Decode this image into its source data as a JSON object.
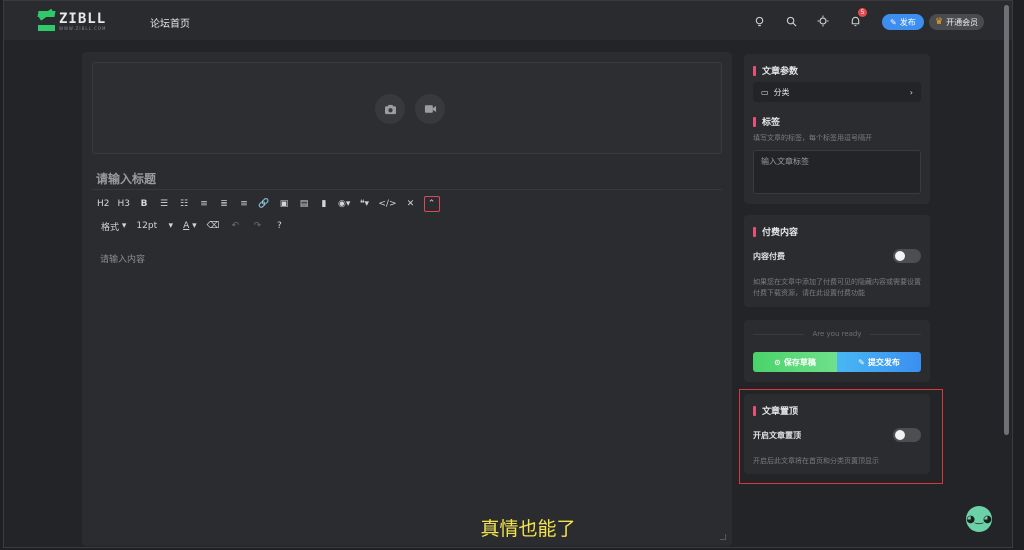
{
  "header": {
    "logo_text": "ZIBLL",
    "logo_sub": "WWW.ZIBLL.COM",
    "nav_home": "论坛首页",
    "notification_count": "5",
    "publish_label": "发布",
    "vip_label": "开通会员"
  },
  "editor": {
    "title_placeholder": "请输入标题",
    "toolbar": {
      "h2": "H2",
      "h3": "H3",
      "bold": "B",
      "format": "格式",
      "font_size": "12pt",
      "font_color": "A"
    },
    "content_placeholder": "请输入内容"
  },
  "sidebar": {
    "params_title": "文章参数",
    "category_label": "分类",
    "tags_title": "标签",
    "tags_hint": "填写文章的标签，每个标签用逗号隔开",
    "tags_placeholder": "输入文章标签",
    "paid_title": "付费内容",
    "paid_toggle_label": "内容付费",
    "paid_hint": "如果您在文章中添加了付费可见的隐藏内容或需要设置付费下载资源，请在此设置付费功能",
    "ready_text": "Are you ready",
    "save_draft": "保存草稿",
    "submit_publish": "提交发布",
    "pin_title": "文章置顶",
    "pin_toggle_label": "开启文章置顶",
    "pin_hint": "开启后此文章将在首页和分类页置顶显示"
  },
  "caption": "真情也能了",
  "icons": {
    "bulb": "bulb-icon",
    "search": "search-icon",
    "theme": "theme-icon",
    "bell": "bell-icon",
    "camera": "camera-icon",
    "video": "video-icon"
  }
}
